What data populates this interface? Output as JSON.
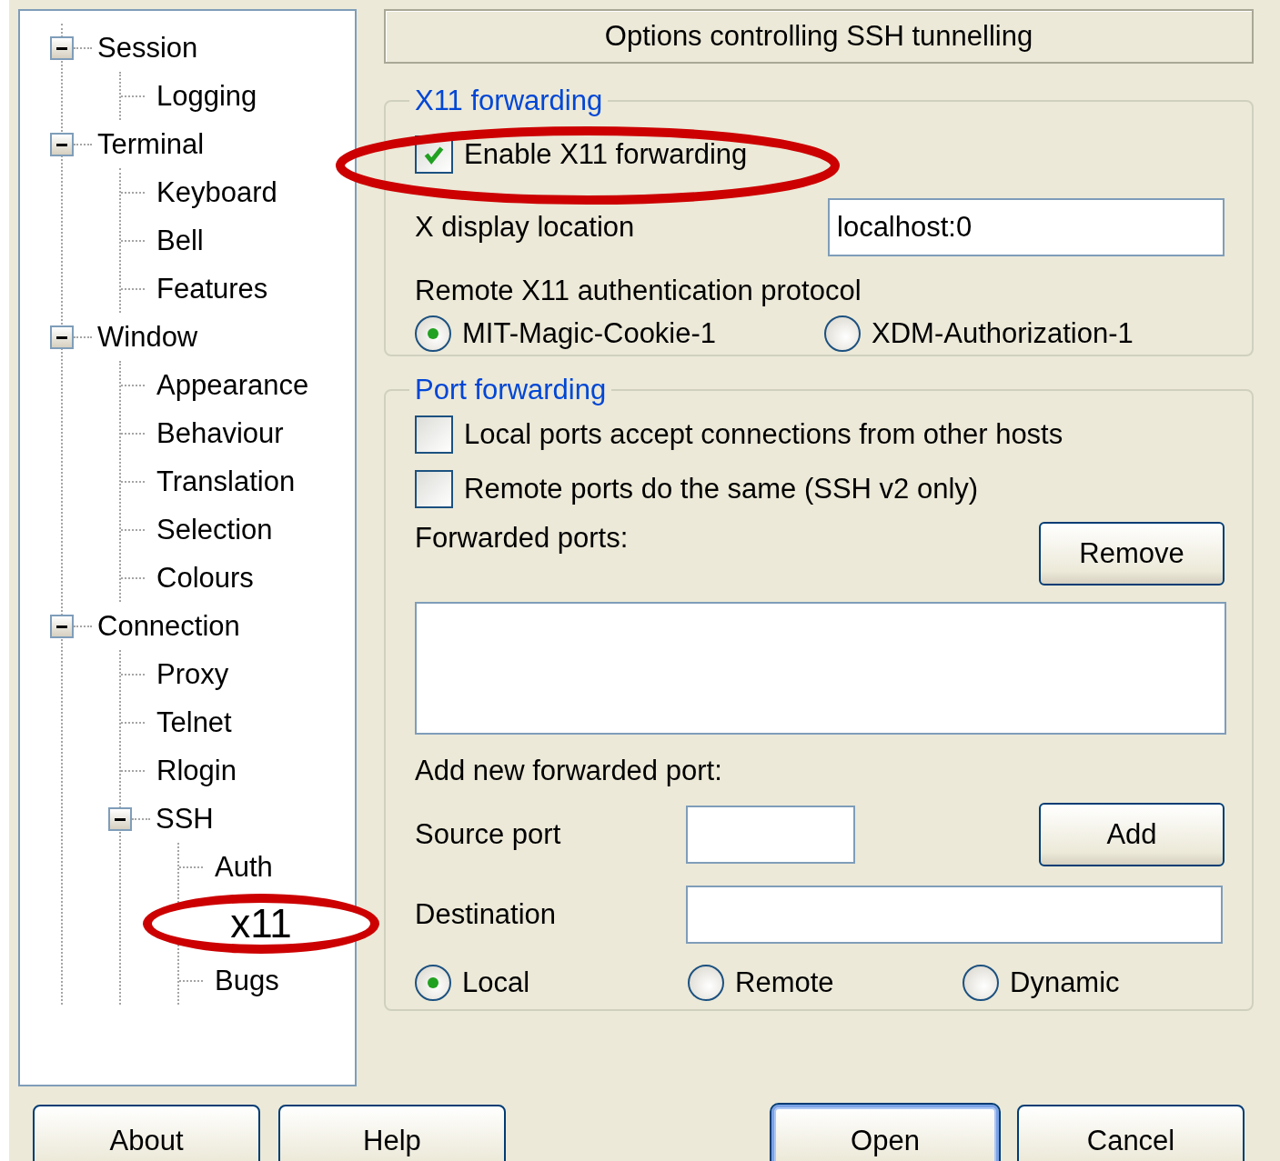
{
  "tree": [
    {
      "label": "Session",
      "expanded": true,
      "children": [
        {
          "label": "Logging"
        }
      ]
    },
    {
      "label": "Terminal",
      "expanded": true,
      "children": [
        {
          "label": "Keyboard"
        },
        {
          "label": "Bell"
        },
        {
          "label": "Features"
        }
      ]
    },
    {
      "label": "Window",
      "expanded": true,
      "children": [
        {
          "label": "Appearance"
        },
        {
          "label": "Behaviour"
        },
        {
          "label": "Translation"
        },
        {
          "label": "Selection"
        },
        {
          "label": "Colours"
        }
      ]
    },
    {
      "label": "Connection",
      "expanded": true,
      "children": [
        {
          "label": "Proxy"
        },
        {
          "label": "Telnet"
        },
        {
          "label": "Rlogin"
        },
        {
          "label": "SSH",
          "expanded": true,
          "children": [
            {
              "label": "Auth"
            },
            {
              "kind": "callout",
              "label": "x11"
            },
            {
              "label": "Bugs"
            }
          ]
        }
      ]
    }
  ],
  "panel_title": "Options controlling SSH tunnelling",
  "x11_group": {
    "title": "X11 forwarding",
    "enable": {
      "label": "Enable X11 forwarding",
      "checked": true
    },
    "display_label": "X display location",
    "display_value": "localhost:0",
    "protocol_label": "Remote X11 authentication protocol",
    "protocols": [
      {
        "label": "MIT-Magic-Cookie-1",
        "selected": true
      },
      {
        "label": "XDM-Authorization-1",
        "selected": false
      }
    ]
  },
  "port_group": {
    "title": "Port forwarding",
    "options": [
      {
        "label": "Local ports accept connections from other hosts",
        "checked": false
      },
      {
        "label": "Remote ports do the same (SSH v2 only)",
        "checked": false
      }
    ],
    "forwarded_label": "Forwarded ports:",
    "remove_button": "Remove",
    "add_label": "Add new forwarded port:",
    "source_label": "Source port",
    "add_button": "Add",
    "destination_label": "Destination",
    "directions": [
      {
        "label": "Local",
        "selected": true
      },
      {
        "label": "Remote",
        "selected": false
      },
      {
        "label": "Dynamic",
        "selected": false
      }
    ]
  },
  "buttons": [
    {
      "label": "About",
      "default": false
    },
    {
      "label": "Help",
      "default": false
    },
    {
      "label": "Open",
      "default": true
    },
    {
      "label": "Cancel",
      "default": false
    }
  ],
  "annotations": [
    {
      "kind": "ellipse"
    }
  ]
}
